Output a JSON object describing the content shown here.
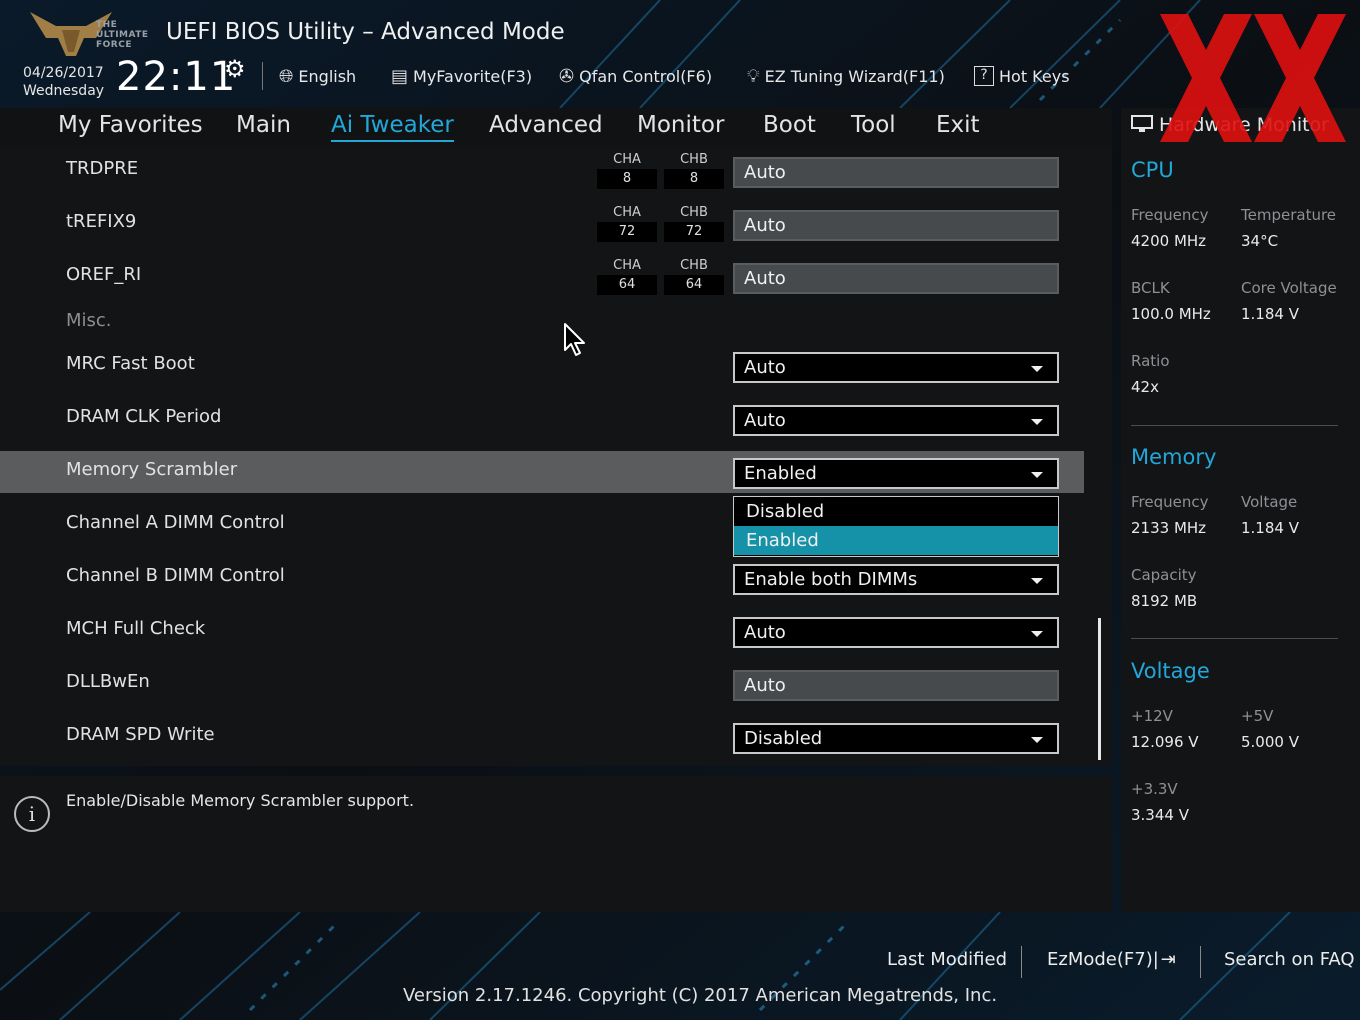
{
  "header": {
    "title": "UEFI BIOS Utility – Advanced Mode",
    "logo_text": [
      "THE",
      "ULTIMATE",
      "FORCE"
    ],
    "date": "04/26/2017",
    "weekday": "Wednesday",
    "time": "22:11",
    "toolbar": [
      {
        "label": "English",
        "icon": "globe-icon"
      },
      {
        "label": "MyFavorite(F3)",
        "icon": "favorite-list-icon"
      },
      {
        "label": "Qfan Control(F6)",
        "icon": "fan-icon"
      },
      {
        "label": "EZ Tuning Wizard(F11)",
        "icon": "lightbulb-icon"
      },
      {
        "label": "Hot Keys",
        "icon": "help-box-icon"
      }
    ]
  },
  "nav": {
    "tabs": [
      "My Favorites",
      "Main",
      "Ai Tweaker",
      "Advanced",
      "Monitor",
      "Boot",
      "Tool",
      "Exit"
    ],
    "active": "Ai Tweaker",
    "accent": "#22a7d8"
  },
  "channel_rows": [
    {
      "label": "TRDPRE",
      "cha_label": "CHA",
      "cha": "8",
      "chb_label": "CHB",
      "chb": "8",
      "value": "Auto"
    },
    {
      "label": "tREFIX9",
      "cha_label": "CHA",
      "cha": "72",
      "chb_label": "CHB",
      "chb": "72",
      "value": "Auto"
    },
    {
      "label": "OREF_RI",
      "cha_label": "CHA",
      "cha": "64",
      "chb_label": "CHB",
      "chb": "64",
      "value": "Auto"
    }
  ],
  "section_misc": "Misc.",
  "settings": [
    {
      "label": "MRC Fast Boot",
      "value": "Auto",
      "type": "dropdown"
    },
    {
      "label": "DRAM CLK Period",
      "value": "Auto",
      "type": "dropdown"
    },
    {
      "label": "Memory Scrambler",
      "value": "Enabled",
      "type": "dropdown",
      "selected": true
    },
    {
      "label": "Channel A DIMM Control",
      "value": "",
      "type": "hidden"
    },
    {
      "label": "Channel B DIMM Control",
      "value": "Enable both DIMMs",
      "type": "dropdown"
    },
    {
      "label": "MCH Full Check",
      "value": "Auto",
      "type": "dropdown"
    },
    {
      "label": "DLLBwEn",
      "value": "Auto",
      "type": "readonly"
    },
    {
      "label": "DRAM SPD Write",
      "value": "Disabled",
      "type": "dropdown"
    }
  ],
  "dropdown_open": {
    "options": [
      "Disabled",
      "Enabled"
    ],
    "selected": "Enabled",
    "highlight_color": "#1692a8"
  },
  "help": {
    "text": "Enable/Disable Memory Scrambler support."
  },
  "hardware_monitor": {
    "title": "Hardware Monitor",
    "cpu": {
      "title": "CPU",
      "frequency_label": "Frequency",
      "frequency": "4200 MHz",
      "temperature_label": "Temperature",
      "temperature": "34°C",
      "bclk_label": "BCLK",
      "bclk": "100.0 MHz",
      "core_voltage_label": "Core Voltage",
      "core_voltage": "1.184 V",
      "ratio_label": "Ratio",
      "ratio": "42x"
    },
    "memory": {
      "title": "Memory",
      "frequency_label": "Frequency",
      "frequency": "2133 MHz",
      "voltage_label": "Voltage",
      "voltage": "1.184 V",
      "capacity_label": "Capacity",
      "capacity": "8192 MB"
    },
    "voltage": {
      "title": "Voltage",
      "v12_label": "+12V",
      "v12": "12.096 V",
      "v5_label": "+5V",
      "v5": "5.000 V",
      "v33_label": "+3.3V",
      "v33": "3.344 V"
    }
  },
  "footer": {
    "last_modified": "Last Modified",
    "ezmode": "EzMode(F7)|",
    "search_faq": "Search on FAQ",
    "version": "Version 2.17.1246. Copyright (C) 2017 American Megatrends, Inc."
  },
  "watermark_color": "#e01010"
}
